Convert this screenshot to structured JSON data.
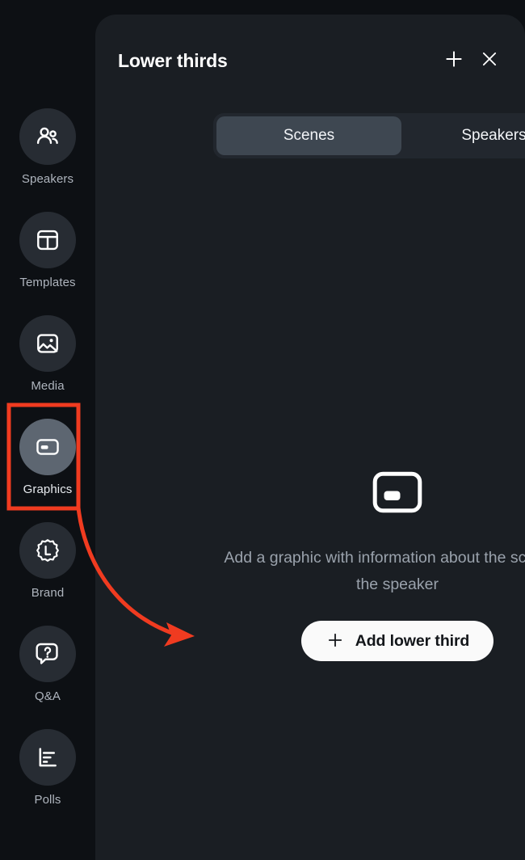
{
  "colors": {
    "page_background": "#0D1014",
    "panel_background": "#1A1E23",
    "rail_circle": "#272C33",
    "rail_circle_active": "#5D6671",
    "tab_track": "#22272E",
    "tab_active": "#3E4751",
    "accent_button": "#FAFAFA",
    "annotation_red": "#F03B20",
    "muted_text": "#9AA2AC"
  },
  "sidebar": {
    "items": [
      {
        "label": "Speakers",
        "icon": "speakers-icon",
        "active": false
      },
      {
        "label": "Templates",
        "icon": "templates-icon",
        "active": false
      },
      {
        "label": "Media",
        "icon": "media-icon",
        "active": false
      },
      {
        "label": "Graphics",
        "icon": "graphics-icon",
        "active": true
      },
      {
        "label": "Brand",
        "icon": "brand-icon",
        "active": false
      },
      {
        "label": "Q&A",
        "icon": "qa-icon",
        "active": false
      },
      {
        "label": "Polls",
        "icon": "polls-icon",
        "active": false
      }
    ]
  },
  "panel": {
    "title": "Lower thirds",
    "add_icon": "plus-icon",
    "close_icon": "close-icon",
    "tabs": [
      {
        "label": "Scenes",
        "active": true
      },
      {
        "label": "Speakers",
        "active": false
      }
    ],
    "empty_state": {
      "icon": "lower-third-icon",
      "message": "Add a graphic with information about the scene or the speaker",
      "button_label": "Add lower third",
      "button_icon": "plus-icon"
    }
  },
  "annotation": {
    "highlight_target": "Graphics",
    "arrow_points_to": "Add lower third"
  }
}
